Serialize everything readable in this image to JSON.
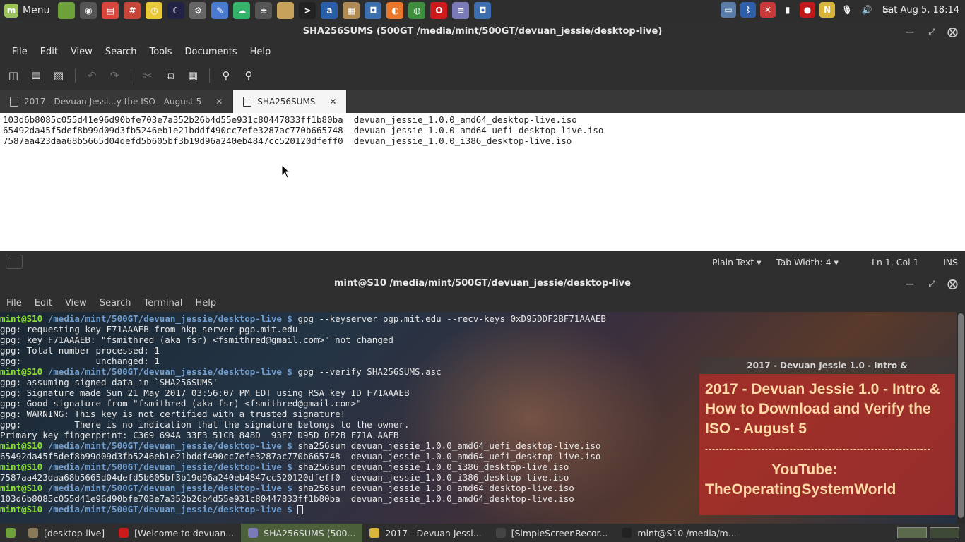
{
  "top_panel": {
    "menu_label": "Menu",
    "mint_glyph": "m",
    "launchers": [
      {
        "icon": "folder-green-icon",
        "color": "#6fa13a",
        "glyph": ""
      },
      {
        "icon": "webcam-icon",
        "color": "#555555",
        "glyph": "◉"
      },
      {
        "icon": "stacks-icon",
        "color": "#d9473c",
        "glyph": "▤"
      },
      {
        "icon": "grid-tool-icon",
        "color": "#c8453a",
        "glyph": "#"
      },
      {
        "icon": "clock-icon",
        "color": "#e9c93a",
        "glyph": "◷"
      },
      {
        "icon": "moon-icon",
        "color": "#222244",
        "glyph": "☾"
      },
      {
        "icon": "settings-icon",
        "color": "#666666",
        "glyph": "⚙"
      },
      {
        "icon": "paint-icon",
        "color": "#4a7bd0",
        "glyph": "✎"
      },
      {
        "icon": "chat-icon",
        "color": "#36b36a",
        "glyph": "☁"
      },
      {
        "icon": "calculator-icon",
        "color": "#555555",
        "glyph": "±"
      },
      {
        "icon": "files-icon",
        "color": "#c7a25a",
        "glyph": ""
      },
      {
        "icon": "terminal-icon",
        "color": "#222222",
        "glyph": ">"
      },
      {
        "icon": "amazon-icon",
        "color": "#2b5ea8",
        "glyph": "a"
      },
      {
        "icon": "archive-icon",
        "color": "#b08a55",
        "glyph": "▦"
      },
      {
        "icon": "camera-icon",
        "color": "#3b6fb0",
        "glyph": "◘"
      },
      {
        "icon": "firefox-icon",
        "color": "#e8762b",
        "glyph": "◐"
      },
      {
        "icon": "chrome-icon",
        "color": "#3d8f3d",
        "glyph": "◍"
      },
      {
        "icon": "opera-icon",
        "color": "#cc1b1b",
        "glyph": "O"
      },
      {
        "icon": "notes-icon",
        "color": "#7a7ab8",
        "glyph": "≡"
      },
      {
        "icon": "screenshot-icon",
        "color": "#3b6fb0",
        "glyph": "◘"
      }
    ],
    "tray": [
      {
        "icon": "display-icon",
        "color": "#5a7ca8",
        "glyph": "▭"
      },
      {
        "icon": "bluetooth-icon",
        "color": "#2f5fa8",
        "glyph": "ᛒ"
      },
      {
        "icon": "shield-icon",
        "color": "#c83a3a",
        "glyph": "✕"
      },
      {
        "icon": "signal-icon",
        "color": "#2e2e2e",
        "glyph": "▮"
      },
      {
        "icon": "record-icon",
        "color": "#c01818",
        "glyph": "●"
      },
      {
        "icon": "notes-yellow-icon",
        "color": "#d9b43a",
        "glyph": "N"
      },
      {
        "icon": "microphone-icon",
        "color": "#2e2e2e",
        "glyph": "🎙"
      },
      {
        "icon": "volume-icon",
        "color": "#2e2e2e",
        "glyph": "🔊"
      },
      {
        "icon": "battery-icon",
        "color": "#2e2e2e",
        "glyph": "▭"
      }
    ],
    "clock": "Sat Aug  5, 18:14"
  },
  "gedit": {
    "title": "SHA256SUMS (500GT /media/mint/500GT/devuan_jessie/desktop-live)",
    "menu": [
      "File",
      "Edit",
      "View",
      "Search",
      "Tools",
      "Documents",
      "Help"
    ],
    "tabs": [
      {
        "label": "2017 - Devuan Jessi...y the ISO - August 5",
        "active": false
      },
      {
        "label": "SHA256SUMS",
        "active": true
      }
    ],
    "lines": [
      "103d6b8085c055d41e96d90bfe703e7a352b26b4d55e931c80447833ff1b80ba  devuan_jessie_1.0.0_amd64_desktop-live.iso",
      "65492da45f5def8b99d09d3fb5246eb1e21bddf490cc7efe3287ac770b665748  devuan_jessie_1.0.0_amd64_uefi_desktop-live.iso",
      "7587aa423daa68b5665d04defd5b605bf3b19d96a240eb4847cc520120dfeff0  devuan_jessie_1.0.0_i386_desktop-live.iso"
    ],
    "status": {
      "language": "Plain Text",
      "tab_width": "Tab Width:  4",
      "position": "Ln 1, Col 1",
      "mode": "INS"
    }
  },
  "terminal": {
    "title": "mint@S10 /media/mint/500GT/devuan_jessie/desktop-live",
    "menu": [
      "File",
      "Edit",
      "View",
      "Search",
      "Terminal",
      "Help"
    ],
    "prompt_user": "mint@S10",
    "prompt_path": "/media/mint/500GT/devuan_jessie/desktop-live $",
    "lines": [
      {
        "type": "cmd",
        "text": "gpg --keyserver pgp.mit.edu --recv-keys 0xD95DDF2BF71AAAEB"
      },
      {
        "type": "out",
        "text": "gpg: requesting key F71AAAEB from hkp server pgp.mit.edu"
      },
      {
        "type": "out",
        "text": "gpg: key F71AAAEB: \"fsmithred (aka fsr) <fsmithred@gmail.com>\" not changed"
      },
      {
        "type": "out",
        "text": "gpg: Total number processed: 1"
      },
      {
        "type": "out",
        "text": "gpg:              unchanged: 1"
      },
      {
        "type": "cmd",
        "text": "gpg --verify SHA256SUMS.asc"
      },
      {
        "type": "out",
        "text": "gpg: assuming signed data in `SHA256SUMS'"
      },
      {
        "type": "out",
        "text": "gpg: Signature made Sun 21 May 2017 03:56:07 PM EDT using RSA key ID F71AAAEB"
      },
      {
        "type": "out",
        "text": "gpg: Good signature from \"fsmithred (aka fsr) <fsmithred@gmail.com>\""
      },
      {
        "type": "out",
        "text": "gpg: WARNING: This key is not certified with a trusted signature!"
      },
      {
        "type": "out",
        "text": "gpg:          There is no indication that the signature belongs to the owner."
      },
      {
        "type": "out",
        "text": "Primary key fingerprint: C369 694A 33F3 51CB 848D  93E7 D95D DF2B F71A AAEB"
      },
      {
        "type": "cmd",
        "text": "sha256sum devuan_jessie_1.0.0_amd64_uefi_desktop-live.iso"
      },
      {
        "type": "out",
        "text": "65492da45f5def8b99d09d3fb5246eb1e21bddf490cc7efe3287ac770b665748  devuan_jessie_1.0.0_amd64_uefi_desktop-live.iso"
      },
      {
        "type": "cmd",
        "text": "sha256sum devuan_jessie_1.0.0_i386_desktop-live.iso"
      },
      {
        "type": "out",
        "text": "7587aa423daa68b5665d04defd5b605bf3b19d96a240eb4847cc520120dfeff0  devuan_jessie_1.0.0_i386_desktop-live.iso"
      },
      {
        "type": "cmd",
        "text": "sha256sum devuan_jessie_1.0.0_amd64_desktop-live.iso"
      },
      {
        "type": "out",
        "text": "103d6b8085c055d41e96d90bfe703e7a352b26b4d55e931c80447833ff1b80ba  devuan_jessie_1.0.0_amd64_desktop-live.iso"
      },
      {
        "type": "cmd",
        "text": ""
      }
    ]
  },
  "overlay": {
    "window_title": "2017 - Devuan Jessie 1.0 - Intro &",
    "heading": "2017 - Devuan Jessie 1.0 - Intro & How to Download and Verify the ISO - August 5",
    "rule": "----------------------------------------------------------------",
    "youtube_label": "YouTube:",
    "channel": "TheOperatingSystemWorld"
  },
  "taskbar": {
    "items": [
      {
        "label": "[desktop-live]",
        "icon": "folder-icon",
        "color": "#8a7a5a",
        "active": false
      },
      {
        "label": "[Welcome to devuan...",
        "icon": "opera-icon",
        "color": "#cc1b1b",
        "active": false
      },
      {
        "label": "SHA256SUMS (500...",
        "icon": "text-editor-icon",
        "color": "#7a7ab8",
        "active": true
      },
      {
        "label": "2017 - Devuan Jessi...",
        "icon": "notes-icon",
        "color": "#d9b43a",
        "active": false
      },
      {
        "label": "[SimpleScreenRecor...",
        "icon": "recorder-icon",
        "color": "#444444",
        "active": false
      },
      {
        "label": "mint@S10 /media/m...",
        "icon": "terminal-icon",
        "color": "#222222",
        "active": false
      }
    ]
  }
}
